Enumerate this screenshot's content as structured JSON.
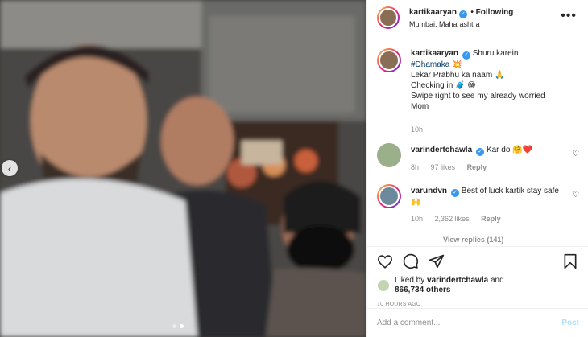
{
  "post": {
    "username": "kartikaaryan",
    "following_label": "Following",
    "location": "Mumbai, Maharashtra"
  },
  "caption": {
    "username": "kartikaaryan",
    "text_1": "Shuru karein",
    "hashtag": "#Dhamaka",
    "emoji_1": "💥",
    "line_2": "Lekar Prabhu ka naam",
    "emoji_2": "🙏",
    "line_3": "Checking in",
    "emoji_3": "🧳 😁",
    "line_4": "Swipe right to see my already worried Mom",
    "time": "10h"
  },
  "comments": [
    {
      "username": "varindertchawla",
      "text": "Kar do",
      "emoji": "🤗❤️",
      "time": "8h",
      "likes": "97 likes",
      "reply": "Reply"
    },
    {
      "username": "varundvn",
      "text": "Best of luck kartik stay safe",
      "emoji": "🙌",
      "time": "10h",
      "likes": "2,362 likes",
      "reply": "Reply",
      "view_replies": "View replies (141)"
    }
  ],
  "likes": {
    "liked_by_prefix": "Liked by",
    "liked_by_user": "varindertchawla",
    "and": "and",
    "others": "866,734 others"
  },
  "time_ago": "10 HOURS AGO",
  "add_comment": {
    "placeholder": "Add a comment...",
    "post_label": "Post"
  },
  "icons": {
    "prev": "chevron-left-icon",
    "more": "more-options-icon",
    "like": "heart-icon",
    "comment": "comment-icon",
    "share": "share-icon",
    "save": "bookmark-icon"
  },
  "colors": {
    "verified": "#3897f0",
    "hashtag": "#00376b",
    "muted": "#8e8e8e",
    "post_button": "#b2dffc"
  },
  "carousel": {
    "slide_count": 2,
    "active_slide": 2
  }
}
